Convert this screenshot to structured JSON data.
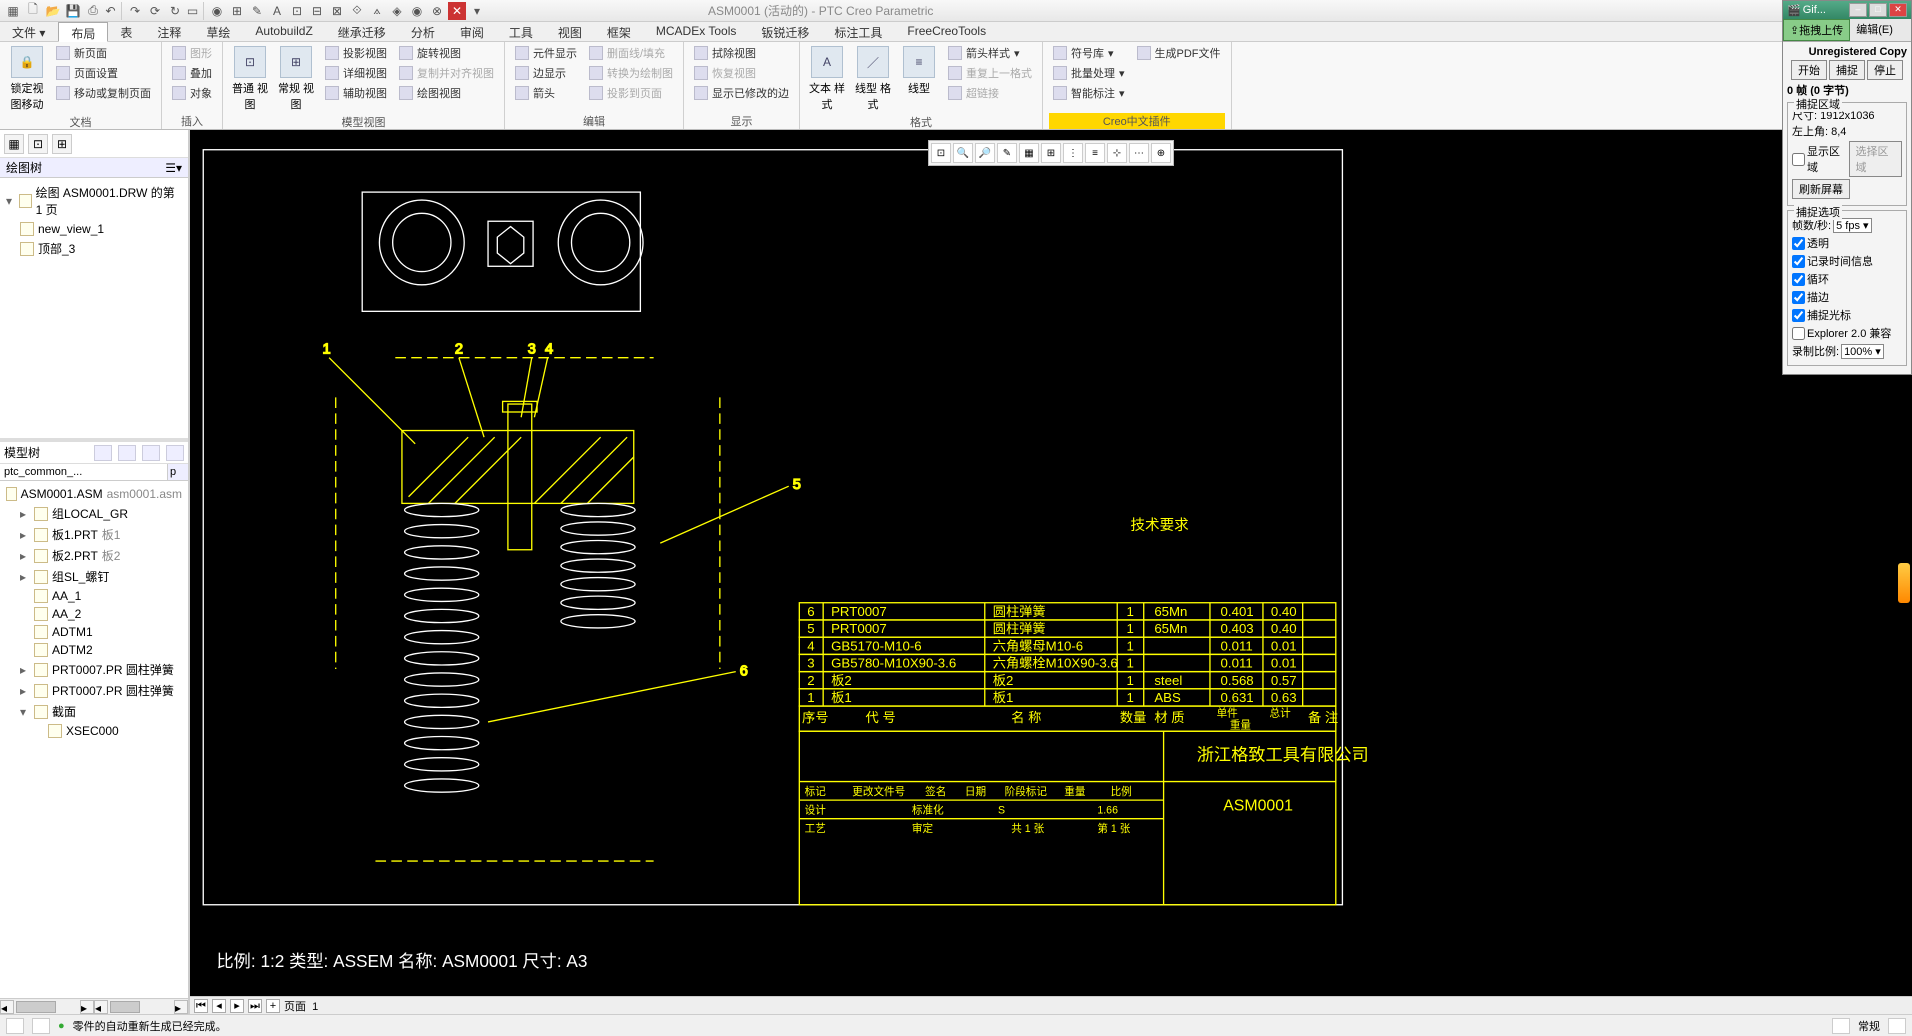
{
  "title": "ASM0001 (活动的) - PTC Creo Parametric",
  "tabs": [
    "文件",
    "布局",
    "表",
    "注释",
    "草绘",
    "AutobuildZ",
    "继承迁移",
    "分析",
    "审阅",
    "工具",
    "视图",
    "框架",
    "MCADEx Tools",
    "钣锐迁移",
    "标注工具",
    "FreeCreoTools"
  ],
  "active_tab": 1,
  "ribbon": {
    "g0": {
      "label": "文档",
      "btn": "锁定视\n图移动",
      "items": [
        "新页面",
        "页面设置",
        "移动或复制页面"
      ]
    },
    "g1": {
      "label": "插入",
      "items": [
        "图形",
        "叠加",
        "对象"
      ]
    },
    "g2": {
      "label": "模型视图",
      "big": [
        "普通\n视图",
        "常规\n视图"
      ],
      "items": [
        "投影视图",
        "详细视图",
        "辅助视图",
        "旋转视图",
        "复制并对齐视图",
        "绘图视图"
      ]
    },
    "g3": {
      "label": "编辑",
      "items": [
        "元件显示",
        "边显示",
        "箭头",
        "删面线/填充",
        "转换为绘制图",
        "投影到页面"
      ]
    },
    "g4": {
      "label": "显示",
      "items": [
        "拭除视图",
        "恢复视图",
        "显示已修改的边"
      ]
    },
    "g5": {
      "label": "格式",
      "big": [
        "文本\n样式",
        "线型\n格式",
        "线型"
      ],
      "items": [
        "箭头样式",
        "重复上一格式",
        "超链接"
      ]
    },
    "g6": {
      "label": "Creo中文插件",
      "items": [
        "符号库",
        "批量处理",
        "智能标注",
        "生成PDF文件"
      ]
    }
  },
  "left": {
    "draw_hdr": "绘图树",
    "draw_root": "绘图 ASM0001.DRW 的第 1 页",
    "draw_items": [
      "new_view_1",
      "顶部_3"
    ],
    "model_hdr": "模型树",
    "tabs": [
      "ptc_common_...",
      "p"
    ],
    "model_root_a": "ASM0001.ASM",
    "model_root_b": "asm0001.asm",
    "items": [
      {
        "t": "组LOCAL_GR",
        "i": 1,
        "exp": "▸"
      },
      {
        "t": "板1.PRT",
        "s": "板1",
        "i": 1,
        "exp": "▸"
      },
      {
        "t": "板2.PRT",
        "s": "板2",
        "i": 1,
        "exp": "▸"
      },
      {
        "t": "组SL_螺钉",
        "i": 1,
        "exp": "▸"
      },
      {
        "t": "AA_1",
        "i": 1
      },
      {
        "t": "AA_2",
        "i": 1
      },
      {
        "t": "ADTM1",
        "i": 1
      },
      {
        "t": "ADTM2",
        "i": 1
      },
      {
        "t": "PRT0007.PR 圆柱弹簧",
        "i": 1,
        "exp": "▸"
      },
      {
        "t": "PRT0007.PR 圆柱弹簧",
        "i": 1,
        "exp": "▸"
      },
      {
        "t": "截面",
        "i": 1,
        "exp": "▾"
      },
      {
        "t": "XSEC000",
        "i": 2
      }
    ]
  },
  "canvas_info": "比例: 1:2      类型: ASSEM   名称: ASM0001    尺寸: A3",
  "tech_req": "技术要求",
  "bom_rows": [
    {
      "n": "6",
      "code": "PRT0007",
      "name": "圆柱弹簧",
      "q": "1",
      "m": "65Mn",
      "w1": "0.401",
      "w2": "0.40"
    },
    {
      "n": "5",
      "code": "PRT0007",
      "name": "圆柱弹簧",
      "q": "1",
      "m": "65Mn",
      "w1": "0.403",
      "w2": "0.40"
    },
    {
      "n": "4",
      "code": "GB5170-M10-6",
      "name": "六角螺母M10-6",
      "q": "1",
      "m": "",
      "w1": "0.011",
      "w2": "0.01"
    },
    {
      "n": "3",
      "code": "GB5780-M10X90-3.6",
      "name": "六角螺栓M10X90-3.6",
      "q": "1",
      "m": "",
      "w1": "0.011",
      "w2": "0.01"
    },
    {
      "n": "2",
      "code": "板2",
      "name": "板2",
      "q": "1",
      "m": "steel",
      "w1": "0.568",
      "w2": "0.57"
    },
    {
      "n": "1",
      "code": "板1",
      "name": "板1",
      "q": "1",
      "m": "ABS",
      "w1": "0.631",
      "w2": "0.63"
    }
  ],
  "bom_hdr": {
    "seq": "序号",
    "code": "代    号",
    "name": "名          称",
    "qty": "数量",
    "mat": "材    质",
    "unit": "单件",
    "tot": "总计",
    "rem": "备  注",
    "weight": "重量"
  },
  "title_block": {
    "company": "浙江格致工具有限公司",
    "dwg": "ASM0001",
    "mark": "标记",
    "chg": "更改文件号",
    "sign": "签名",
    "date": "日期",
    "design": "设计",
    "std": "标准化",
    "stage": "阶段标记",
    "wt": "重量",
    "scale": "比例",
    "sheet": "共 1 张",
    "this": "第 1 张",
    "check": "工艺",
    "approve": "审定",
    "tot_sheets": "1",
    "scalev": "1.66"
  },
  "sheet": {
    "lbl": "页面",
    "num": "1"
  },
  "status_msg": "零件的自动重新生成已经完成。",
  "status_right": "常规",
  "gif": {
    "title": "Gif...",
    "send": "拖拽上传",
    "edit": "编辑(E)",
    "unreg": "Unregistered Copy",
    "start": "开始",
    "cap": "捕捉",
    "stop": "停止",
    "frames": "0 帧 (0 字节)",
    "region_t": "捕捉区域",
    "size": "尺寸: 1912x1036",
    "corner": "左上角: 8,4",
    "show_region": "显示区域",
    "sel_region": "选择区域",
    "refresh": "刷新屏幕",
    "opts_t": "捕捉选项",
    "fps_l": "帧数/秒:",
    "fps": "5 fps",
    "transp": "透明",
    "timestamp": "记录时间信息",
    "loop": "循环",
    "desc": "描边",
    "cursor": "捕捉光标",
    "expl": "Explorer 2.0 兼容",
    "scale_l": "录制比例:",
    "scale": "100%"
  }
}
